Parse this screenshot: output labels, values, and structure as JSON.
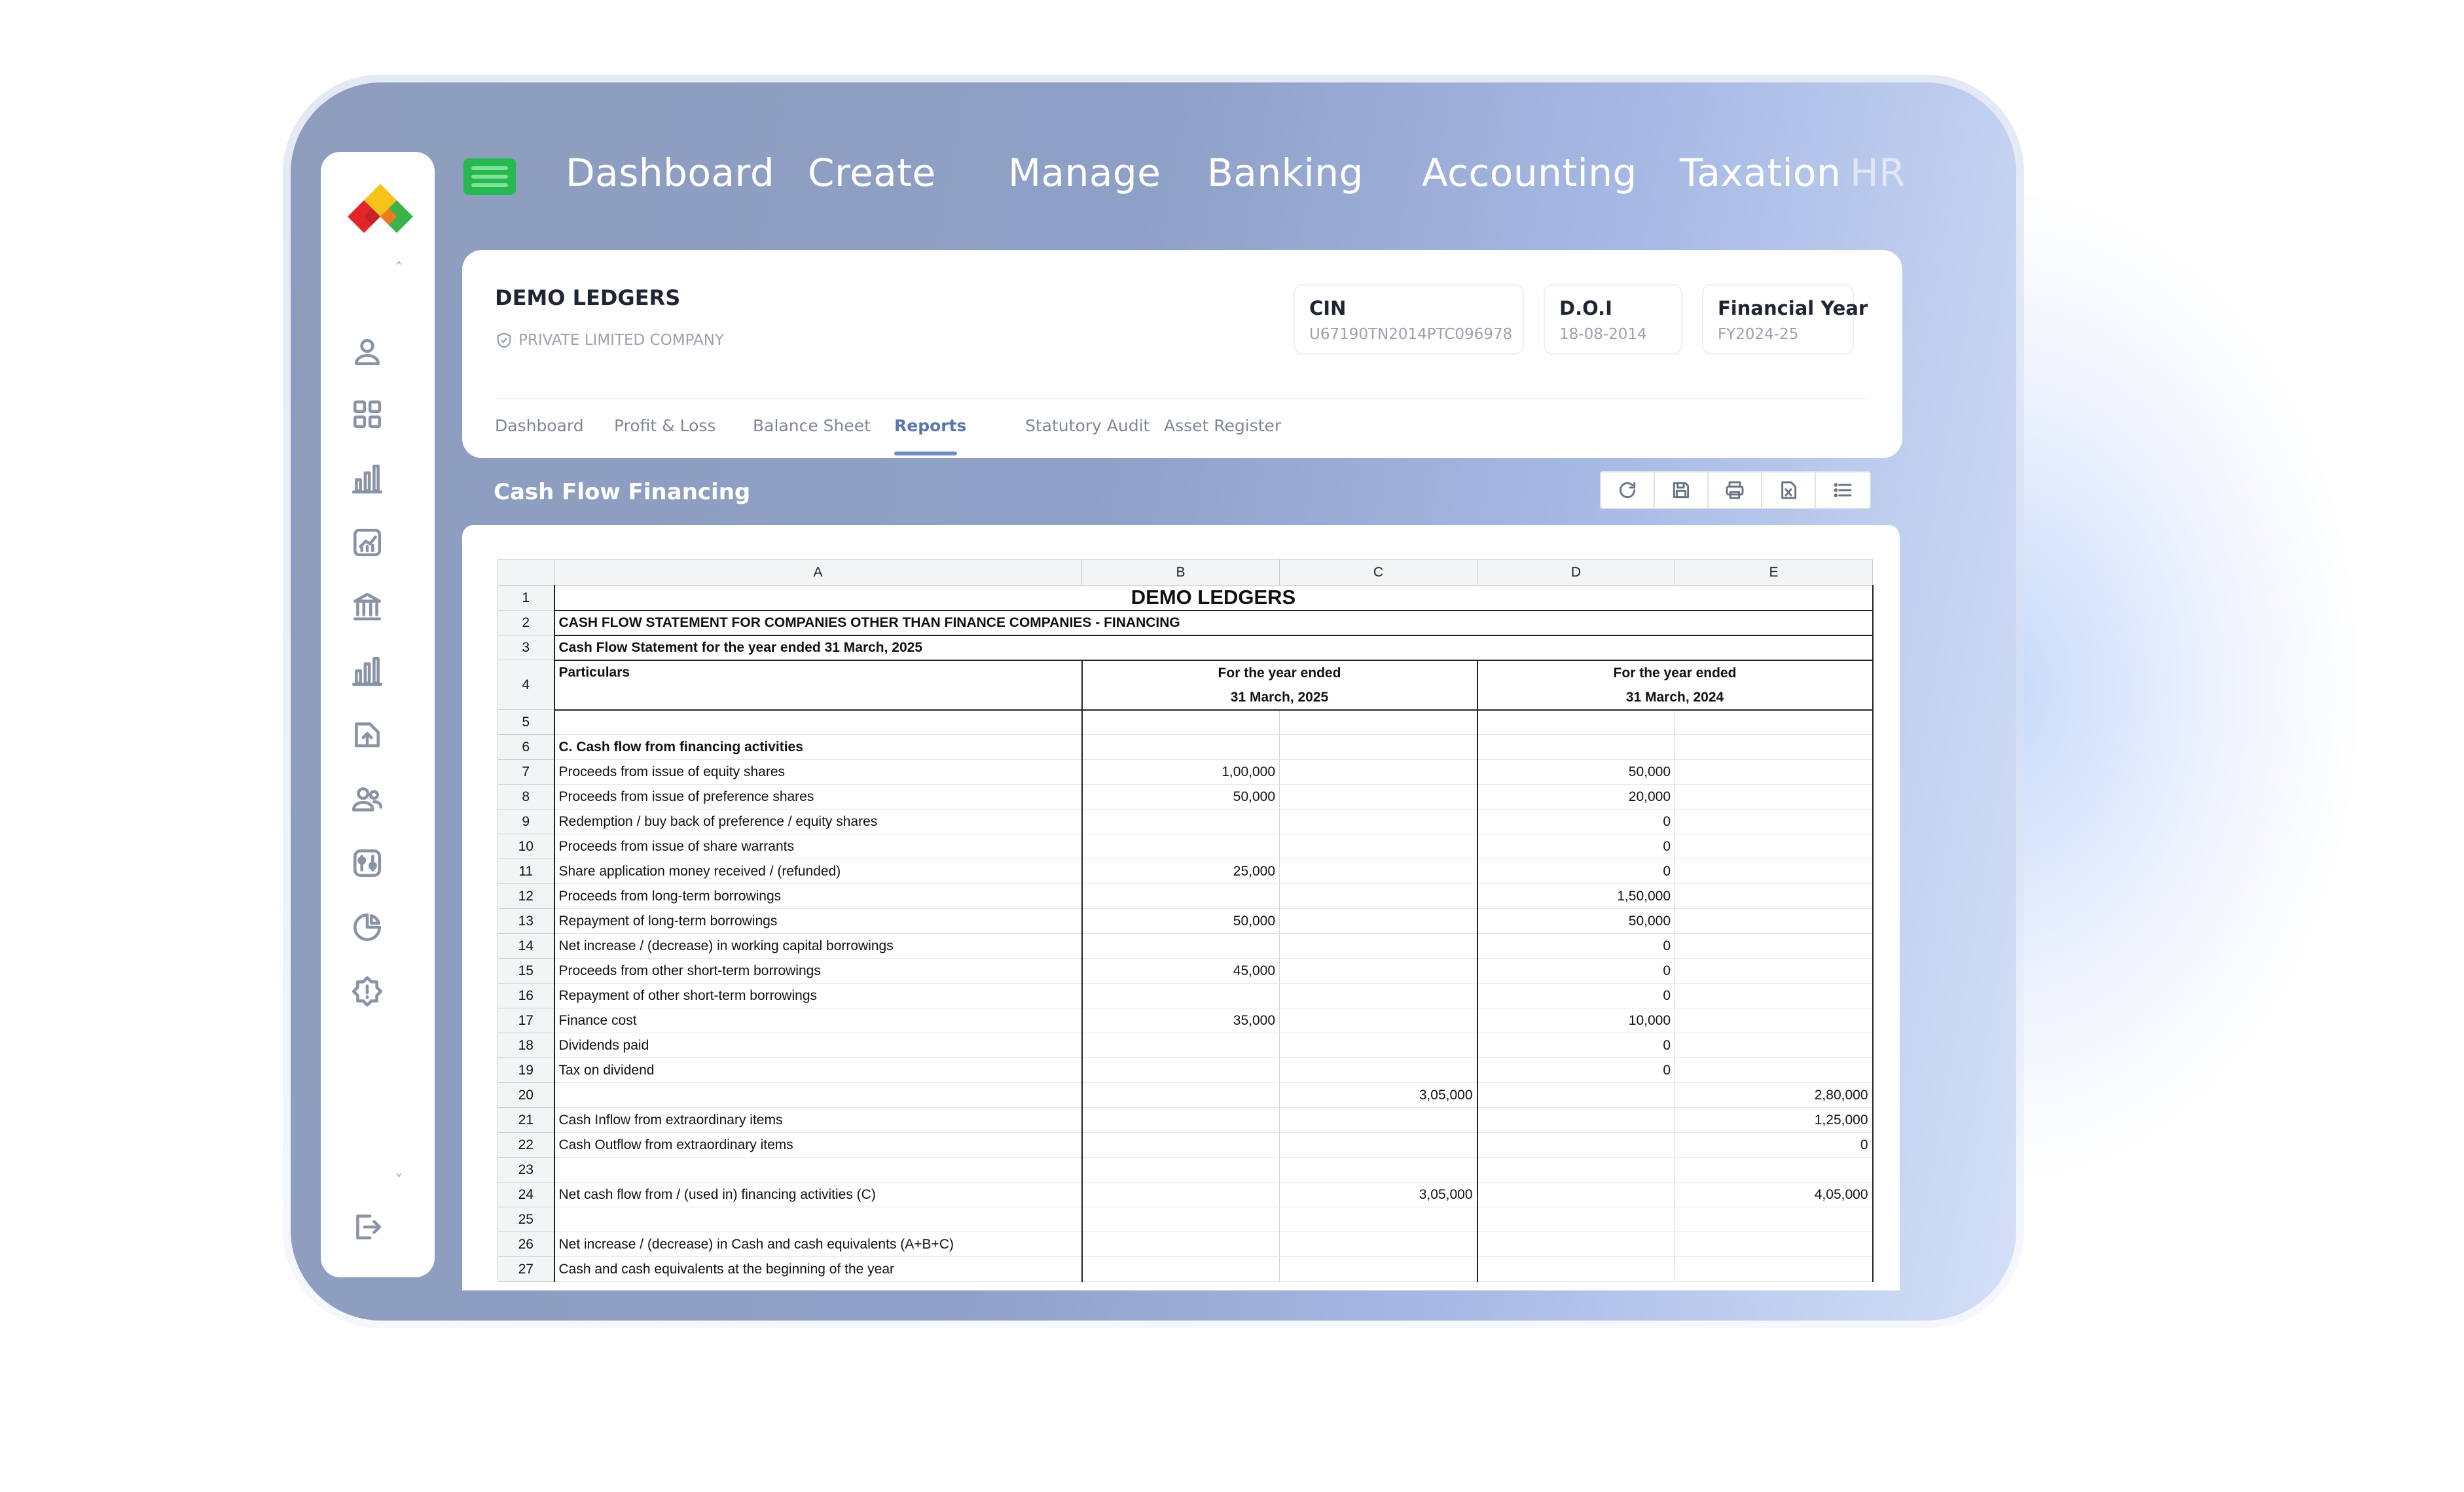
{
  "nav": {
    "items": [
      "Dashboard",
      "Create",
      "Manage",
      "Banking",
      "Accounting",
      "Taxation",
      "HR"
    ]
  },
  "sidebar": {
    "icons": [
      "user-icon",
      "grid-icon",
      "bar-chart-icon",
      "trend-chart-icon",
      "bank-icon",
      "stats-icon",
      "upload-folder-icon",
      "users-icon",
      "settings-sliders-icon",
      "pie-chart-icon",
      "alert-icon",
      "logout-icon"
    ]
  },
  "company": {
    "name": "DEMO LEDGERS",
    "type": "PRIVATE LIMITED COMPANY",
    "cin_label": "CIN",
    "cin_value": "U67190TN2014PTC096978",
    "doi_label": "D.O.I",
    "doi_value": "18-08-2014",
    "fy_label": "Financial Year",
    "fy_value": "FY2024-25"
  },
  "tabs": [
    "Dashboard",
    "Profit & Loss",
    "Balance Sheet",
    "Reports",
    "Statutory Audit",
    "Asset Register"
  ],
  "active_tab": "Reports",
  "report": {
    "title": "Cash Flow Financing",
    "toolbar": [
      "refresh-icon",
      "save-icon",
      "print-icon",
      "excel-icon",
      "list-icon"
    ]
  },
  "sheet": {
    "columns": [
      "A",
      "B",
      "C",
      "D",
      "E"
    ],
    "title": "DEMO LEDGERS",
    "heading1": "CASH FLOW STATEMENT FOR COMPANIES OTHER THAN FINANCE COMPANIES - FINANCING",
    "heading2": "Cash Flow Statement for the year ended 31 March, 2025",
    "particulars": "Particulars",
    "year1_line1": "For the year ended",
    "year1_line2": "31 March, 2025",
    "year2_line1": "For the year ended",
    "year2_line2": "31 March, 2024",
    "rows": [
      {
        "n": "5",
        "a": "",
        "b": "",
        "c": "",
        "d": "",
        "e": ""
      },
      {
        "n": "6",
        "a": "C. Cash flow from financing activities",
        "b": "",
        "c": "",
        "d": "",
        "e": "",
        "bold": true
      },
      {
        "n": "7",
        "a": "Proceeds from issue of equity shares",
        "b": "1,00,000",
        "c": "",
        "d": "50,000",
        "e": ""
      },
      {
        "n": "8",
        "a": "Proceeds from issue of preference shares",
        "b": "50,000",
        "c": "",
        "d": "20,000",
        "e": ""
      },
      {
        "n": "9",
        "a": "Redemption / buy back of preference / equity shares",
        "b": "",
        "c": "",
        "d": "0",
        "e": ""
      },
      {
        "n": "10",
        "a": "Proceeds from issue of share warrants",
        "b": "",
        "c": "",
        "d": "0",
        "e": ""
      },
      {
        "n": "11",
        "a": "Share application money received / (refunded)",
        "b": "25,000",
        "c": "",
        "d": "0",
        "e": ""
      },
      {
        "n": "12",
        "a": "Proceeds from long-term borrowings",
        "b": "",
        "c": "",
        "d": "1,50,000",
        "e": ""
      },
      {
        "n": "13",
        "a": "Repayment of long-term borrowings",
        "b": "50,000",
        "c": "",
        "d": "50,000",
        "e": ""
      },
      {
        "n": "14",
        "a": "Net increase / (decrease) in working capital borrowings",
        "b": "",
        "c": "",
        "d": "0",
        "e": ""
      },
      {
        "n": "15",
        "a": "Proceeds from other short-term borrowings",
        "b": "45,000",
        "c": "",
        "d": "0",
        "e": ""
      },
      {
        "n": "16",
        "a": "Repayment of other short-term borrowings",
        "b": "",
        "c": "",
        "d": "0",
        "e": ""
      },
      {
        "n": "17",
        "a": "Finance cost",
        "b": "35,000",
        "c": "",
        "d": "10,000",
        "e": ""
      },
      {
        "n": "18",
        "a": "Dividends paid",
        "b": "",
        "c": "",
        "d": "0",
        "e": ""
      },
      {
        "n": "19",
        "a": "Tax on dividend",
        "b": "",
        "c": "",
        "d": "0",
        "e": ""
      },
      {
        "n": "20",
        "a": "",
        "b": "",
        "c": "3,05,000",
        "d": "",
        "e": "2,80,000"
      },
      {
        "n": "21",
        "a": "Cash Inflow from extraordinary items",
        "b": "",
        "c": "",
        "d": "",
        "e": "1,25,000"
      },
      {
        "n": "22",
        "a": "Cash Outflow from extraordinary items",
        "b": "",
        "c": "",
        "d": "",
        "e": "0"
      },
      {
        "n": "23",
        "a": "",
        "b": "",
        "c": "",
        "d": "",
        "e": ""
      },
      {
        "n": "24",
        "a": "Net cash flow from / (used in) financing activities (C)",
        "b": "",
        "c": "3,05,000",
        "d": "",
        "e": "4,05,000"
      },
      {
        "n": "25",
        "a": "",
        "b": "",
        "c": "",
        "d": "",
        "e": ""
      },
      {
        "n": "26",
        "a": "Net increase / (decrease) in Cash and cash equivalents (A+B+C)",
        "b": "",
        "c": "",
        "d": "",
        "e": ""
      },
      {
        "n": "27",
        "a": "Cash and cash equivalents at the beginning of the year",
        "b": "",
        "c": "",
        "d": "",
        "e": ""
      }
    ]
  },
  "colors": {
    "accent_green": "#27b84f",
    "active_tab": "#5a76b0"
  }
}
